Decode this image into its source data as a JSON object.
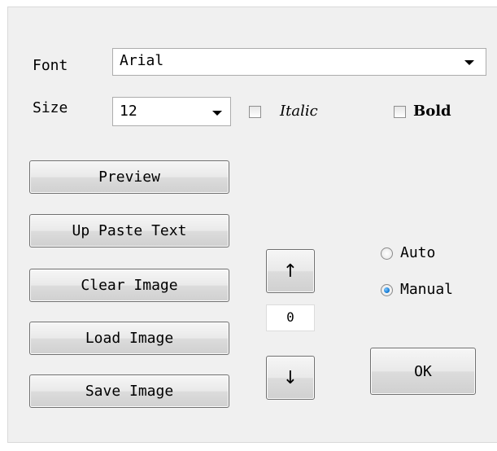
{
  "font_row": {
    "label": "Font",
    "value": "Arial"
  },
  "size_row": {
    "label": "Size",
    "value": "12",
    "italic_label": "Italic",
    "italic_checked": false,
    "bold_label": "Bold",
    "bold_checked": false
  },
  "buttons": {
    "preview": "Preview",
    "up_paste_text": "Up Paste Text",
    "clear_image": "Clear Image",
    "load_image": "Load Image",
    "save_image": "Save Image",
    "up_arrow": "↑",
    "down_arrow": "↓",
    "ok": "OK"
  },
  "counter": {
    "value": "0"
  },
  "mode": {
    "options": [
      "Auto",
      "Manual"
    ],
    "selected": "Manual"
  }
}
